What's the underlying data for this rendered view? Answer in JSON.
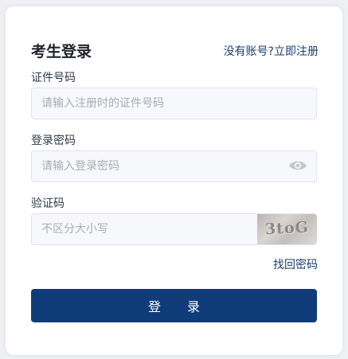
{
  "login": {
    "title": "考生登录",
    "register_link": "没有账号?立即注册",
    "id_label": "证件号码",
    "id_placeholder": "请输入注册时的证件号码",
    "password_label": "登录密码",
    "password_placeholder": "请输入登录密码",
    "captcha_label": "验证码",
    "captcha_placeholder": "不区分大小写",
    "captcha_text": "3toG",
    "forgot_link": "找回密码",
    "submit_label": "登 录"
  },
  "colors": {
    "primary": "#0f3c79",
    "link": "#1a3e73",
    "input_bg": "#f7f8fb"
  },
  "icons": {
    "password_toggle": "eye-icon"
  }
}
